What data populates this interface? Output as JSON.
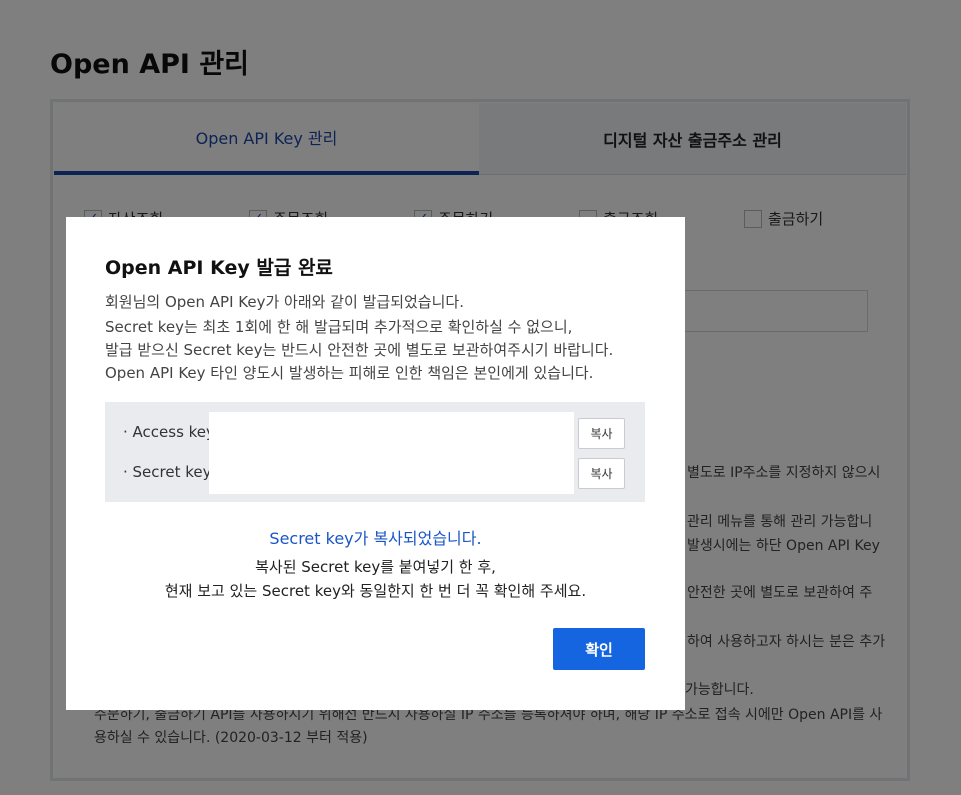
{
  "page": {
    "title": "Open API 관리"
  },
  "tabs": [
    {
      "label": "Open API Key 관리",
      "active": true
    },
    {
      "label": "디지털 자산 출금주소 관리",
      "active": false
    }
  ],
  "permissions": [
    {
      "label": "자산조회",
      "checked": true
    },
    {
      "label": "주문조회",
      "checked": true
    },
    {
      "label": "주문하기",
      "checked": true
    },
    {
      "label": "출금조회",
      "checked": false
    },
    {
      "label": "출금하기",
      "checked": false
    }
  ],
  "notes": [
    "별도로 IP주소를 지정하지 않으시",
    "관리 메뉴를 통해 관리 가능합니",
    "발생시에는 하단 Open API Key",
    "안전한 곳에 별도로 보관하여 주",
    "하여 사용하고자 하시는 분은 추가"
  ],
  "bottom_notes": [
    "가능합니다.",
    "주문하기, 출금하기 API를 사용하시기 위해선 반드시 사용하실 IP 주소를 등록하셔야 하며, 해당 IP 주소로 접속 시에만 Open API를 사",
    "용하실 수 있습니다. (2020-03-12 부터 적용)"
  ],
  "modal": {
    "title": "Open API Key 발급 완료",
    "description": [
      "회원님의 Open API Key가 아래와 같이 발급되었습니다.",
      "Secret key는 최초 1회에 한 해 발급되며 추가적으로 확인하실 수 없으니,",
      "발급 받으신 Secret key는 반드시 안전한 곳에 별도로 보관하여주시기 바랍니다.",
      "Open API Key 타인 양도시 발생하는 피해로 인한 책임은 본인에게 있습니다."
    ],
    "access_key_label": "· Access key",
    "secret_key_label": "· Secret key",
    "copy_label": "복사",
    "copied_message": "Secret key가 복사되었습니다.",
    "instruction": [
      "복사된 Secret key를 붙여넣기 한 후,",
      "현재 보고 있는 Secret key와 동일한지 한 번 더 꼭 확인해 주세요."
    ],
    "confirm_label": "확인"
  },
  "colors": {
    "accent": "#1565e0",
    "tab_active": "#1a47a8",
    "link": "#1a55c7"
  }
}
